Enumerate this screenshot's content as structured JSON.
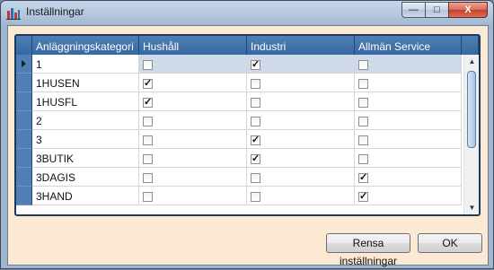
{
  "window": {
    "title": "Inställningar",
    "controls": {
      "minimize": "—",
      "maximize": "□",
      "close": "X"
    }
  },
  "grid": {
    "columns": [
      "Anläggningskategori",
      "Hushåll",
      "Industri",
      "Allmän Service"
    ],
    "rows": [
      {
        "category": "1",
        "hushall": false,
        "industri": true,
        "allman": false
      },
      {
        "category": "1HUSEN",
        "hushall": true,
        "industri": false,
        "allman": false
      },
      {
        "category": "1HUSFL",
        "hushall": true,
        "industri": false,
        "allman": false
      },
      {
        "category": "2",
        "hushall": false,
        "industri": false,
        "allman": false
      },
      {
        "category": "3",
        "hushall": false,
        "industri": true,
        "allman": false
      },
      {
        "category": "3BUTIK",
        "hushall": false,
        "industri": true,
        "allman": false
      },
      {
        "category": "3DAGIS",
        "hushall": false,
        "industri": false,
        "allman": true
      },
      {
        "category": "3HAND",
        "hushall": false,
        "industri": false,
        "allman": true
      }
    ],
    "selected_row": 0
  },
  "buttons": {
    "reset": "Rensa inställningar",
    "ok": "OK"
  },
  "colors": {
    "header": "#3f72ab",
    "frame": "#1c3a5e",
    "background": "#fbe9d4"
  }
}
